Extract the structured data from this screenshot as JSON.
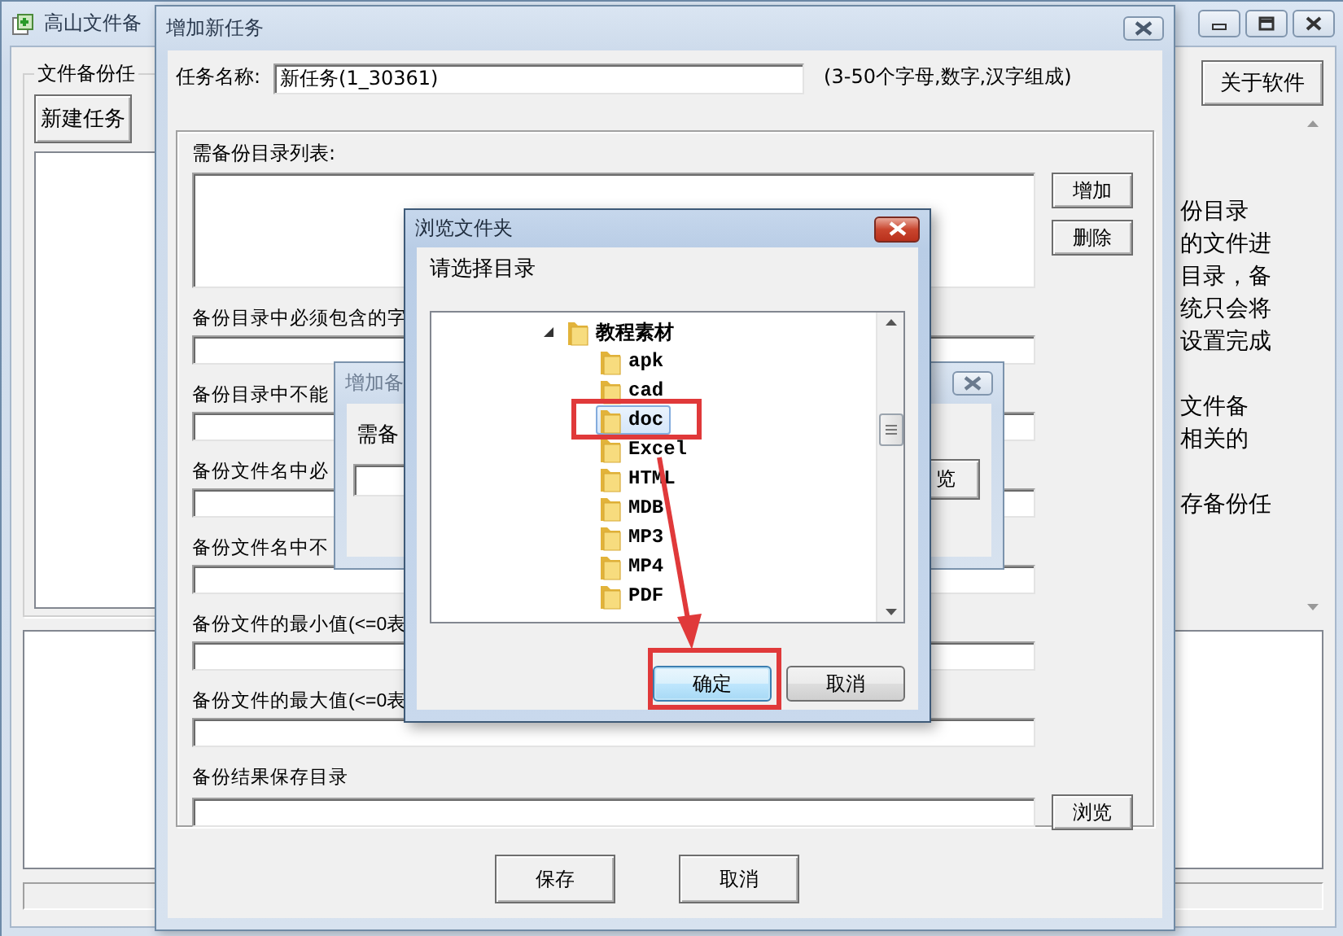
{
  "main_window": {
    "title": "高山文件备",
    "group_label": "文件备份任",
    "new_task_button": "新建任务",
    "about_button": "关于软件",
    "description": [
      {
        "lines": [
          "份目录",
          "的文件进",
          "目录，备",
          "统只会将",
          "设置完成"
        ]
      },
      {
        "lines": [
          "文件备",
          "相关的"
        ]
      },
      {
        "lines": [
          "存备份任"
        ]
      }
    ]
  },
  "task_dialog": {
    "title": "增加新任务",
    "name_label": "任务名称:",
    "name_value": "新任务(1_30361)",
    "name_hint": "(3-50个字母,数字,汉字组成)",
    "dir_list_label": "需备份目录列表:",
    "list_buttons": [
      "增加",
      "删除"
    ],
    "fields": [
      {
        "label": "备份目录中必须包含的字"
      },
      {
        "label": "备份目录中不能"
      },
      {
        "label": "备份文件名中必"
      },
      {
        "label": "备份文件名中不"
      },
      {
        "label": "备份文件的最小值(<=0表"
      },
      {
        "label": "备份文件的最大值(<=0表"
      },
      {
        "label": "备份结果保存目录",
        "button": "浏览"
      }
    ],
    "buttons": [
      "保存",
      "取消"
    ]
  },
  "sub_dialog": {
    "title": "增加备",
    "label": "需备",
    "browse_button": "览"
  },
  "folder_dialog": {
    "title": "浏览文件夹",
    "prompt": "请选择目录",
    "tree": [
      {
        "label": "教程素材",
        "expanded": true,
        "selected": false,
        "children": [
          {
            "label": "apk",
            "selected": false
          },
          {
            "label": "cad",
            "selected": false
          },
          {
            "label": "doc",
            "selected": true
          },
          {
            "label": "Excel",
            "selected": false
          },
          {
            "label": "HTML",
            "selected": false
          },
          {
            "label": "MDB",
            "selected": false
          },
          {
            "label": "MP3",
            "selected": false
          },
          {
            "label": "MP4",
            "selected": false
          },
          {
            "label": "PDF",
            "selected": false
          }
        ]
      }
    ],
    "buttons": [
      {
        "label": "确定",
        "default": true
      },
      {
        "label": "取消",
        "default": false
      }
    ]
  }
}
